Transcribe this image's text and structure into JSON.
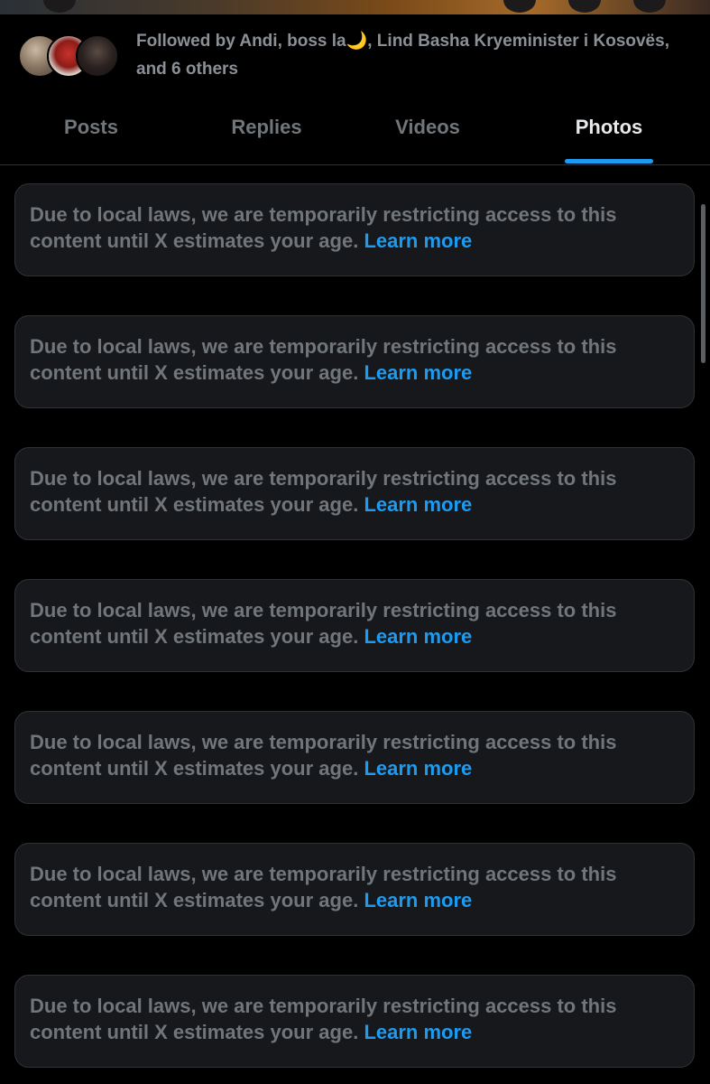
{
  "profile": {
    "followed_by": "Followed by Andi, boss la🌙, Lind Basha Kryeminister i Kosovës, and 6 others"
  },
  "tabs": [
    {
      "label": "Posts",
      "active": false
    },
    {
      "label": "Replies",
      "active": false
    },
    {
      "label": "Videos",
      "active": false
    },
    {
      "label": "Photos",
      "active": true
    }
  ],
  "notices": [
    {
      "text": "Due to local laws, we are temporarily restricting access to this content until X estimates your age.",
      "link": "Learn more"
    },
    {
      "text": "Due to local laws, we are temporarily restricting access to this content until X estimates your age.",
      "link": "Learn more"
    },
    {
      "text": "Due to local laws, we are temporarily restricting access to this content until X estimates your age.",
      "link": "Learn more"
    },
    {
      "text": "Due to local laws, we are temporarily restricting access to this content until X estimates your age.",
      "link": "Learn more"
    },
    {
      "text": "Due to local laws, we are temporarily restricting access to this content until X estimates your age.",
      "link": "Learn more"
    },
    {
      "text": "Due to local laws, we are temporarily restricting access to this content until X estimates your age.",
      "link": "Learn more"
    },
    {
      "text": "Due to local laws, we are temporarily restricting access to this content until X estimates your age.",
      "link": "Learn more"
    }
  ],
  "colors": {
    "accent": "#1d9bf0",
    "background": "#000000",
    "card": "#16181c",
    "muted_text": "#71767b"
  },
  "icons": [
    "avatar-andi",
    "avatar-boss-la",
    "avatar-lind-basha"
  ]
}
